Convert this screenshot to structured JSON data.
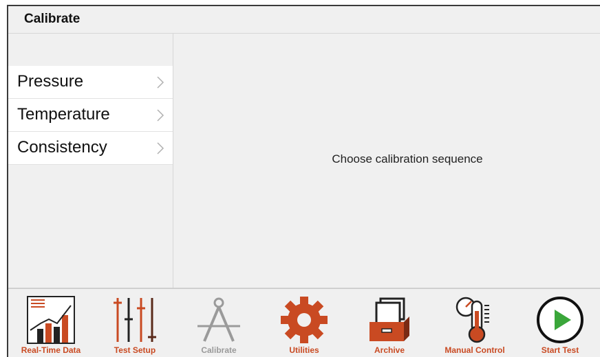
{
  "header": {
    "title": "Calibrate"
  },
  "sidebar": {
    "items": [
      {
        "label": "Pressure"
      },
      {
        "label": "Temperature"
      },
      {
        "label": "Consistency"
      }
    ]
  },
  "main": {
    "prompt": "Choose calibration sequence"
  },
  "toolbar": {
    "items": [
      {
        "label": "Real-Time Data",
        "icon": "chart-icon"
      },
      {
        "label": "Test Setup",
        "icon": "sliders-icon"
      },
      {
        "label": "Calibrate",
        "icon": "compass-icon",
        "state": "disabled"
      },
      {
        "label": "Utilities",
        "icon": "gear-icon"
      },
      {
        "label": "Archive",
        "icon": "file-cabinet-icon"
      },
      {
        "label": "Manual Control",
        "icon": "thermometer-gauge-icon"
      },
      {
        "label": "Start Test",
        "icon": "play-icon"
      }
    ]
  },
  "colors": {
    "accent": "#c94a22",
    "disabled": "#9a9a9a",
    "play": "#3aa63a"
  }
}
